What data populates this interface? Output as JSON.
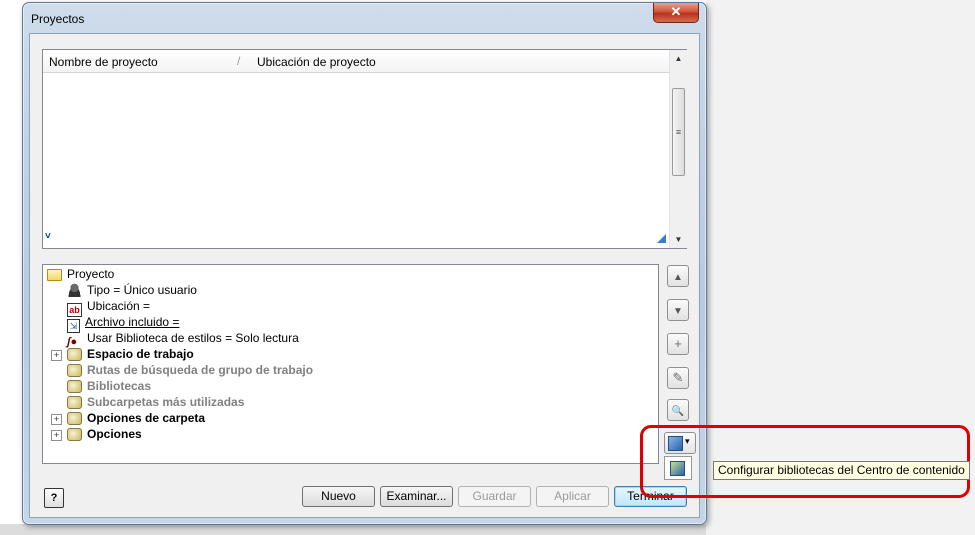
{
  "window": {
    "title": "Proyectos",
    "close_label": "✕"
  },
  "project_list": {
    "columns": [
      "Nombre de proyecto",
      "Ubicación de proyecto"
    ],
    "sort_indicator": "/",
    "chevron": "˅"
  },
  "tree": {
    "items": [
      {
        "label": "Proyecto",
        "icon": "project-folder-icon"
      },
      {
        "label": "Tipo = Único usuario",
        "icon": "user-icon"
      },
      {
        "label": "Ubicación =",
        "icon": "text-field-icon"
      },
      {
        "label": "Archivo incluido =",
        "icon": "included-file-icon"
      },
      {
        "label": "Usar Biblioteca de estilos = Solo lectura",
        "icon": "style-library-icon"
      },
      {
        "label": "Espacio de trabajo",
        "icon": "book-icon",
        "expander": "+"
      },
      {
        "label": "Rutas de búsqueda de grupo de trabajo",
        "icon": "book-icon"
      },
      {
        "label": "Bibliotecas",
        "icon": "book-icon"
      },
      {
        "label": "Subcarpetas más utilizadas",
        "icon": "book-icon"
      },
      {
        "label": "Opciones de carpeta",
        "icon": "book-icon",
        "expander": "+"
      },
      {
        "label": "Opciones",
        "icon": "book-icon",
        "expander": "+"
      }
    ]
  },
  "side_buttons": {
    "move_up": "▲",
    "move_down": "▼",
    "add": "+",
    "edit": "✎",
    "find": "🔍"
  },
  "buttons": {
    "help": "?",
    "new": "Nuevo",
    "browse": "Examinar...",
    "save": "Guardar",
    "apply": "Aplicar",
    "finish": "Terminar"
  },
  "dropdown": {
    "arrow": "▾"
  },
  "tooltip": {
    "text": "Configurar bibliotecas del Centro de contenido"
  },
  "colors": {
    "highlight": "#e00000",
    "tooltip_bg": "#ffffe1"
  }
}
